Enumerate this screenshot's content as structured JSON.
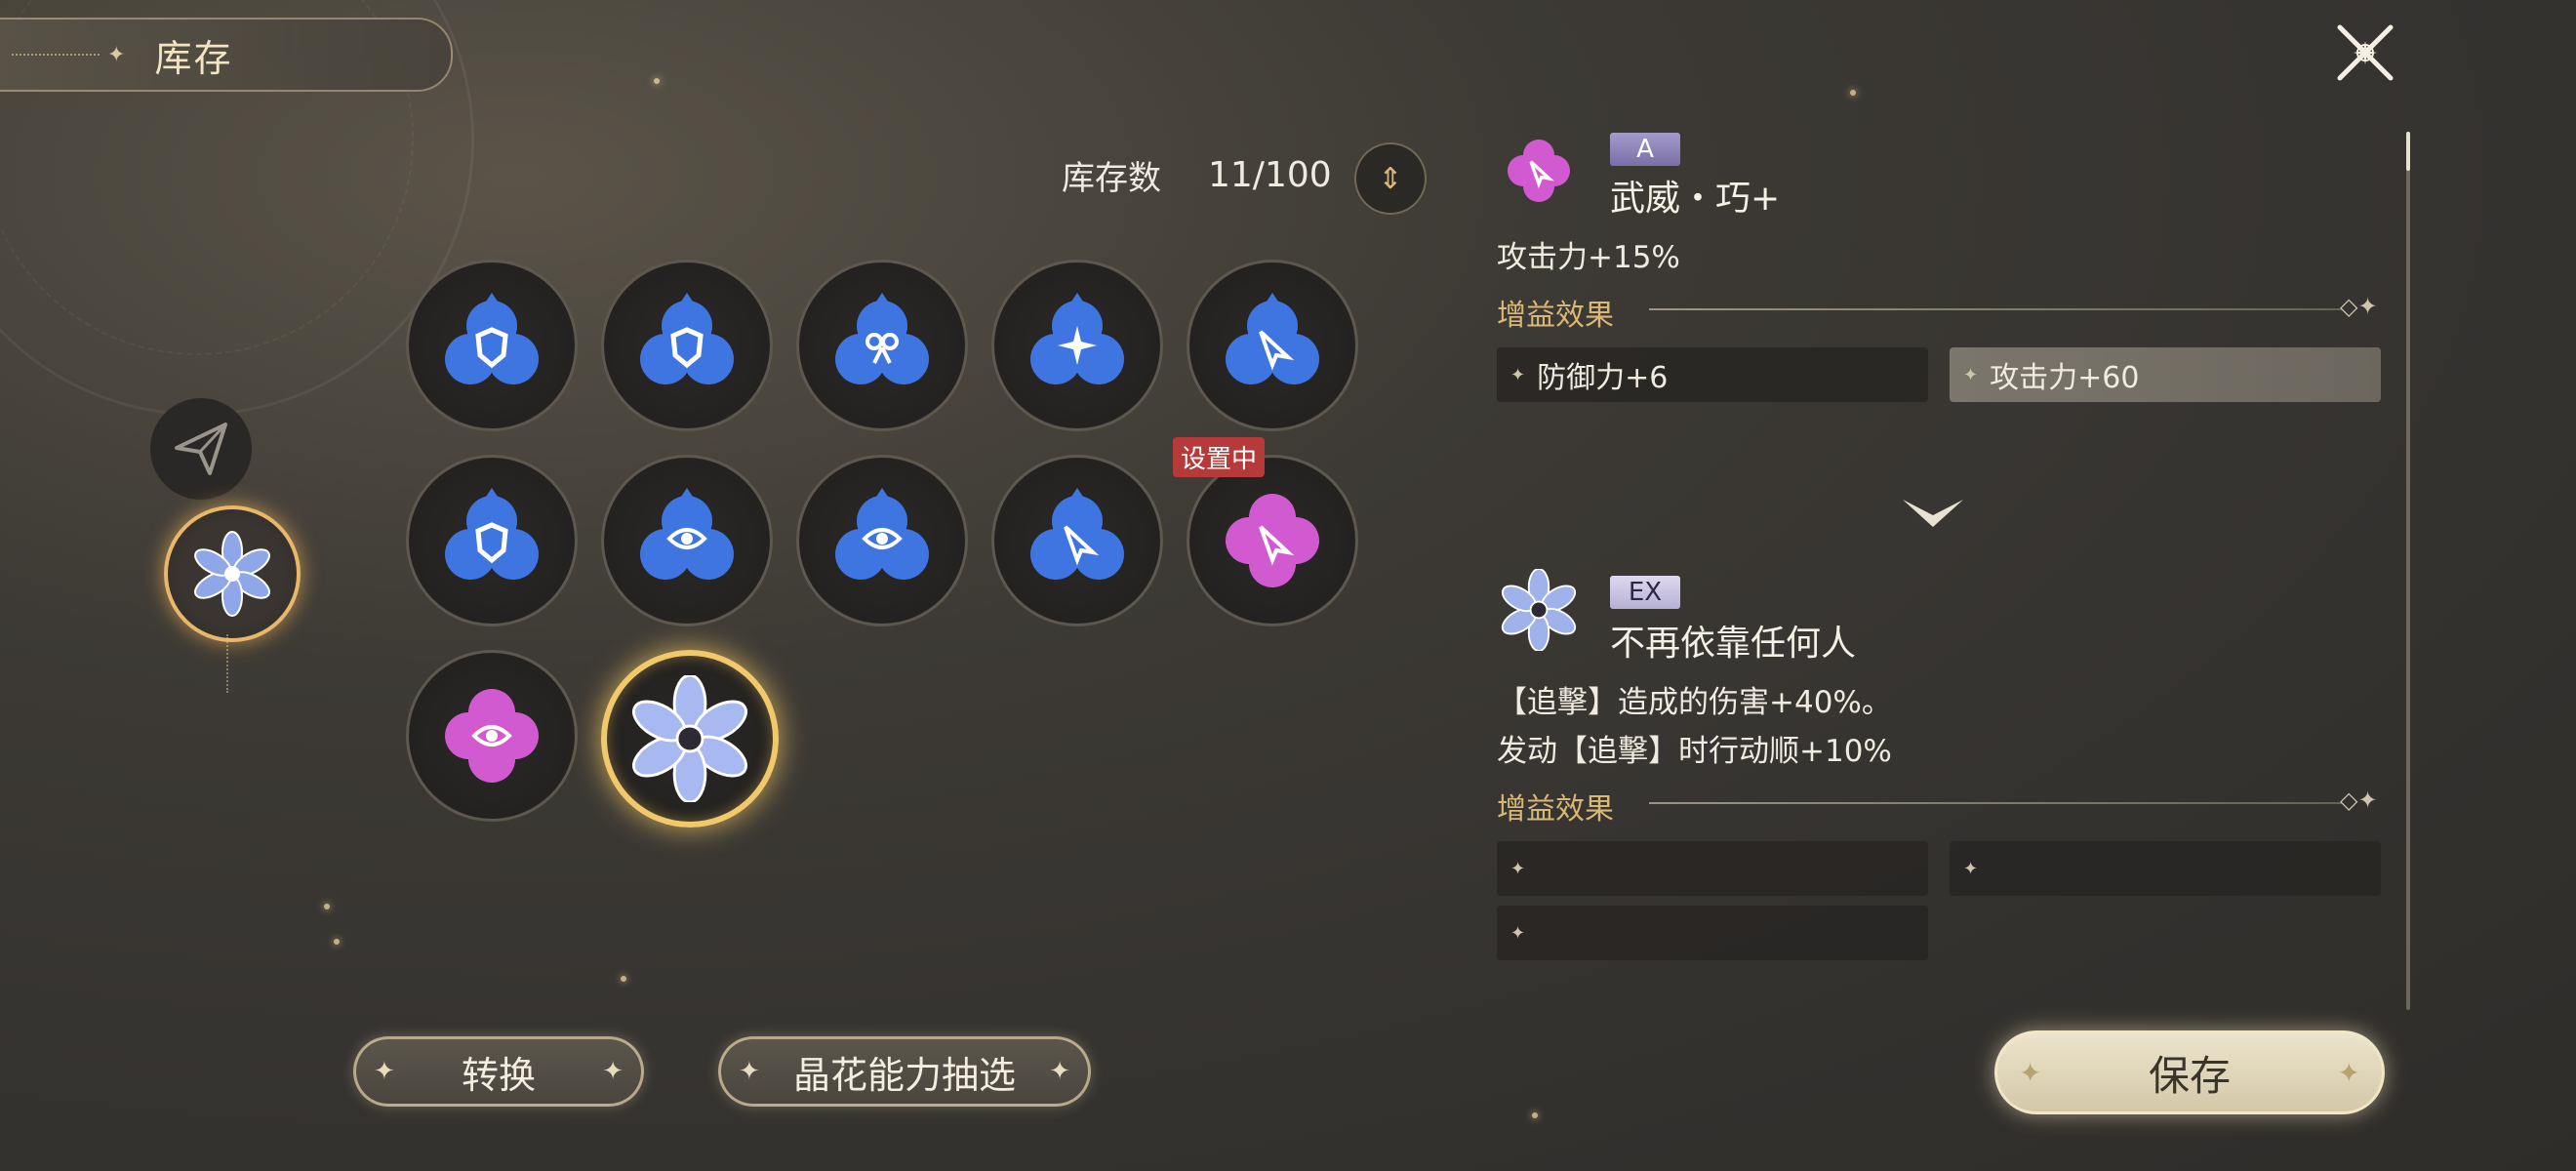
{
  "header": {
    "title": "库存"
  },
  "inventory": {
    "count_label": "库存数",
    "count_value": "11/100"
  },
  "grid": {
    "slots": [
      {
        "color": "blue",
        "icon": "shield-icon"
      },
      {
        "color": "blue",
        "icon": "shield-icon"
      },
      {
        "color": "blue",
        "icon": "knot-icon"
      },
      {
        "color": "blue",
        "icon": "star-burst-icon"
      },
      {
        "color": "blue",
        "icon": "arrow-cursor-icon"
      },
      {
        "color": "blue",
        "icon": "shield-icon"
      },
      {
        "color": "blue",
        "icon": "eye-shield-icon"
      },
      {
        "color": "blue",
        "icon": "eye-shield-icon"
      },
      {
        "color": "blue",
        "icon": "arrow-cursor-icon"
      },
      {
        "color": "pink",
        "icon": "arrow-cursor-icon",
        "badge": "设置中"
      },
      {
        "color": "pink",
        "icon": "eye-shield-icon"
      },
      {
        "color": "rainbow",
        "icon": "flower-icon",
        "selected": true
      }
    ]
  },
  "buttons": {
    "convert": "转换",
    "draw": "晶花能力抽选",
    "save": "保存"
  },
  "panel": {
    "current": {
      "rank": "A",
      "name": "武威・巧+",
      "main_stat": "攻击力+15%",
      "buff_title": "增益效果",
      "buffs": [
        "防御力+6",
        "攻击力+60"
      ]
    },
    "next": {
      "rank": "EX",
      "name": "不再依靠任何人",
      "effect_1": "【追擊】造成的伤害+40%。",
      "effect_2": "发动【追擊】时行动顺+10%",
      "buff_title": "增益效果",
      "buffs": [
        "",
        "",
        ""
      ]
    }
  },
  "colors": {
    "accent_gold": "#f2c96a",
    "badge_red": "#b73a3a",
    "blue_gem": "#3a6fd8",
    "pink_gem": "#d25ad0"
  }
}
